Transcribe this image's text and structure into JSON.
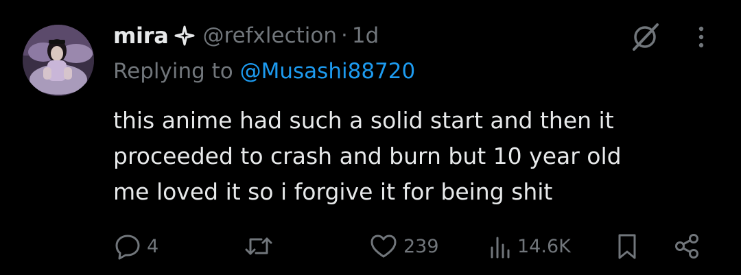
{
  "tweet": {
    "display_name": "mira",
    "handle": "@refxlection",
    "separator": "·",
    "time": "1d",
    "replying_prefix": "Replying to",
    "replying_to": "@Musashi88720",
    "text_lines": [
      "this anime had such a solid start and then it",
      "proceeded to crash and burn but 10 year old",
      "me loved it so i forgive it for being shit"
    ]
  },
  "actions": {
    "reply_count": "4",
    "repost_count": "",
    "like_count": "239",
    "views_count": "14.6K"
  },
  "colors": {
    "background": "#000000",
    "primary_text": "#e7e9ea",
    "secondary_text": "#71767b",
    "accent": "#1d9bf0"
  },
  "icons": {
    "header": [
      "verified-icon",
      "grok-icon",
      "more-icon"
    ],
    "actions": [
      "reply-icon",
      "repost-icon",
      "like-icon",
      "views-icon",
      "bookmark-icon",
      "share-icon"
    ]
  }
}
